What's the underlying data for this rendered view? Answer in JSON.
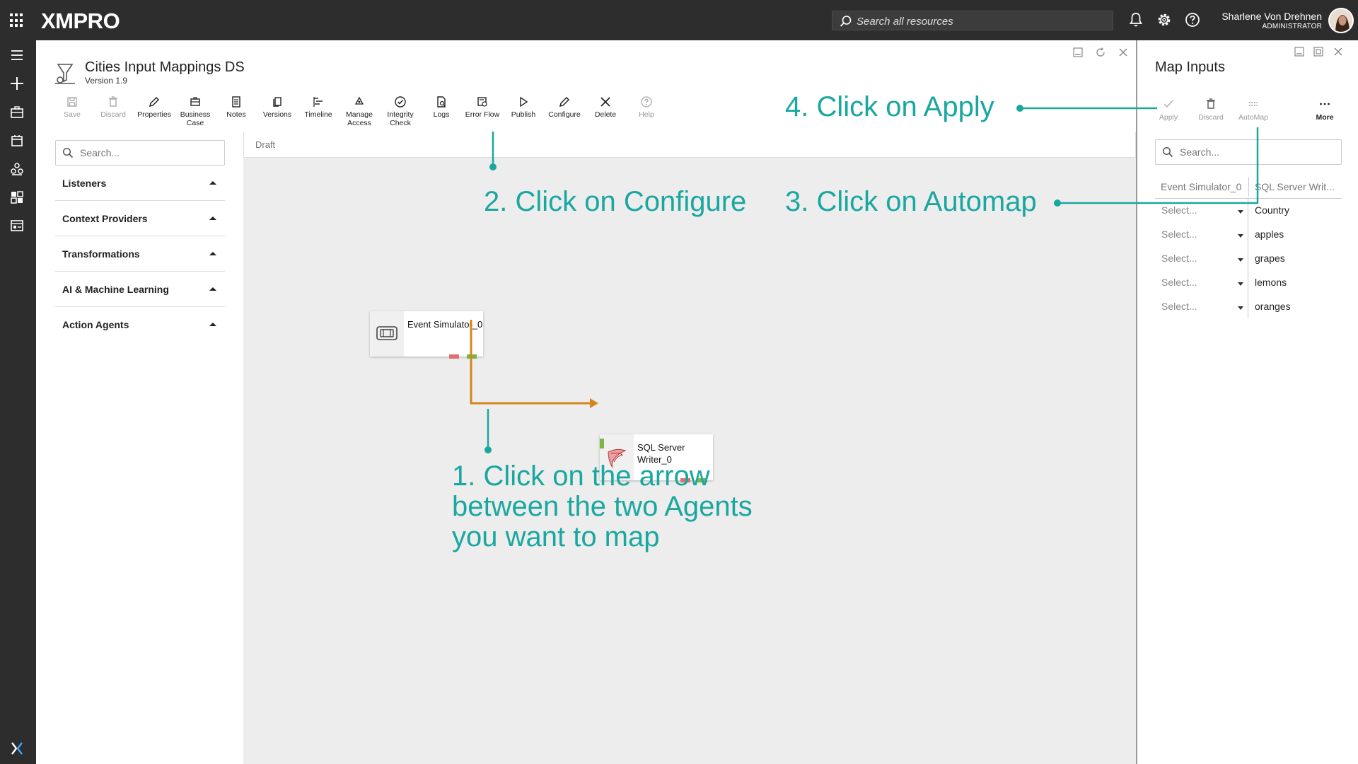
{
  "app": {
    "logo": "XMPRO",
    "search_placeholder": "Search all resources",
    "user_name": "Sharlene Von Drehnen",
    "user_role": "ADMINISTRATOR"
  },
  "datastream": {
    "title": "Cities Input Mappings DS",
    "version": "Version 1.9"
  },
  "toolbar": {
    "save": "Save",
    "discard": "Discard",
    "properties": "Properties",
    "business_case_1": "Business",
    "business_case_2": "Case",
    "notes": "Notes",
    "versions": "Versions",
    "timeline": "Timeline",
    "manage_access_1": "Manage",
    "manage_access_2": "Access",
    "integrity_check_1": "Integrity",
    "integrity_check_2": "Check",
    "logs": "Logs",
    "error_flow": "Error Flow",
    "publish": "Publish",
    "configure": "Configure",
    "delete": "Delete",
    "help": "Help"
  },
  "toolbox": {
    "search_placeholder": "Search...",
    "categories": [
      {
        "label": "Listeners"
      },
      {
        "label": "Context Providers"
      },
      {
        "label": "Transformations"
      },
      {
        "label": "AI & Machine Learning"
      },
      {
        "label": "Action Agents"
      }
    ]
  },
  "canvas": {
    "status": "Draft",
    "agents": [
      {
        "label": "Event Simulator_0"
      },
      {
        "label_line1": "SQL Server",
        "label_line2": "Writer_0"
      }
    ]
  },
  "mapper": {
    "title": "Map Inputs",
    "apply": "Apply",
    "discard": "Discard",
    "automap": "AutoMap",
    "more": "More",
    "search_placeholder": "Search...",
    "col_source": "Event Simulator_0",
    "col_target": "SQL Server Writ...",
    "rows": [
      {
        "source": "Select...",
        "target": "Country"
      },
      {
        "source": "Select...",
        "target": "apples"
      },
      {
        "source": "Select...",
        "target": "grapes"
      },
      {
        "source": "Select...",
        "target": "lemons"
      },
      {
        "source": "Select...",
        "target": "oranges"
      }
    ]
  },
  "annotations": {
    "step1_line1": "1. Click on the arrow",
    "step1_line2": "between the two Agents",
    "step1_line3": "you want to map",
    "step2": "2. Click on Configure",
    "step3": "3. Click on Automap",
    "step4": "4. Click on Apply"
  },
  "colors": {
    "annotation": "#1aa7a0",
    "link": "#d4861c",
    "port_out": "#7ab648",
    "port_err": "#e07070",
    "chrome": "#2d2d2d"
  }
}
